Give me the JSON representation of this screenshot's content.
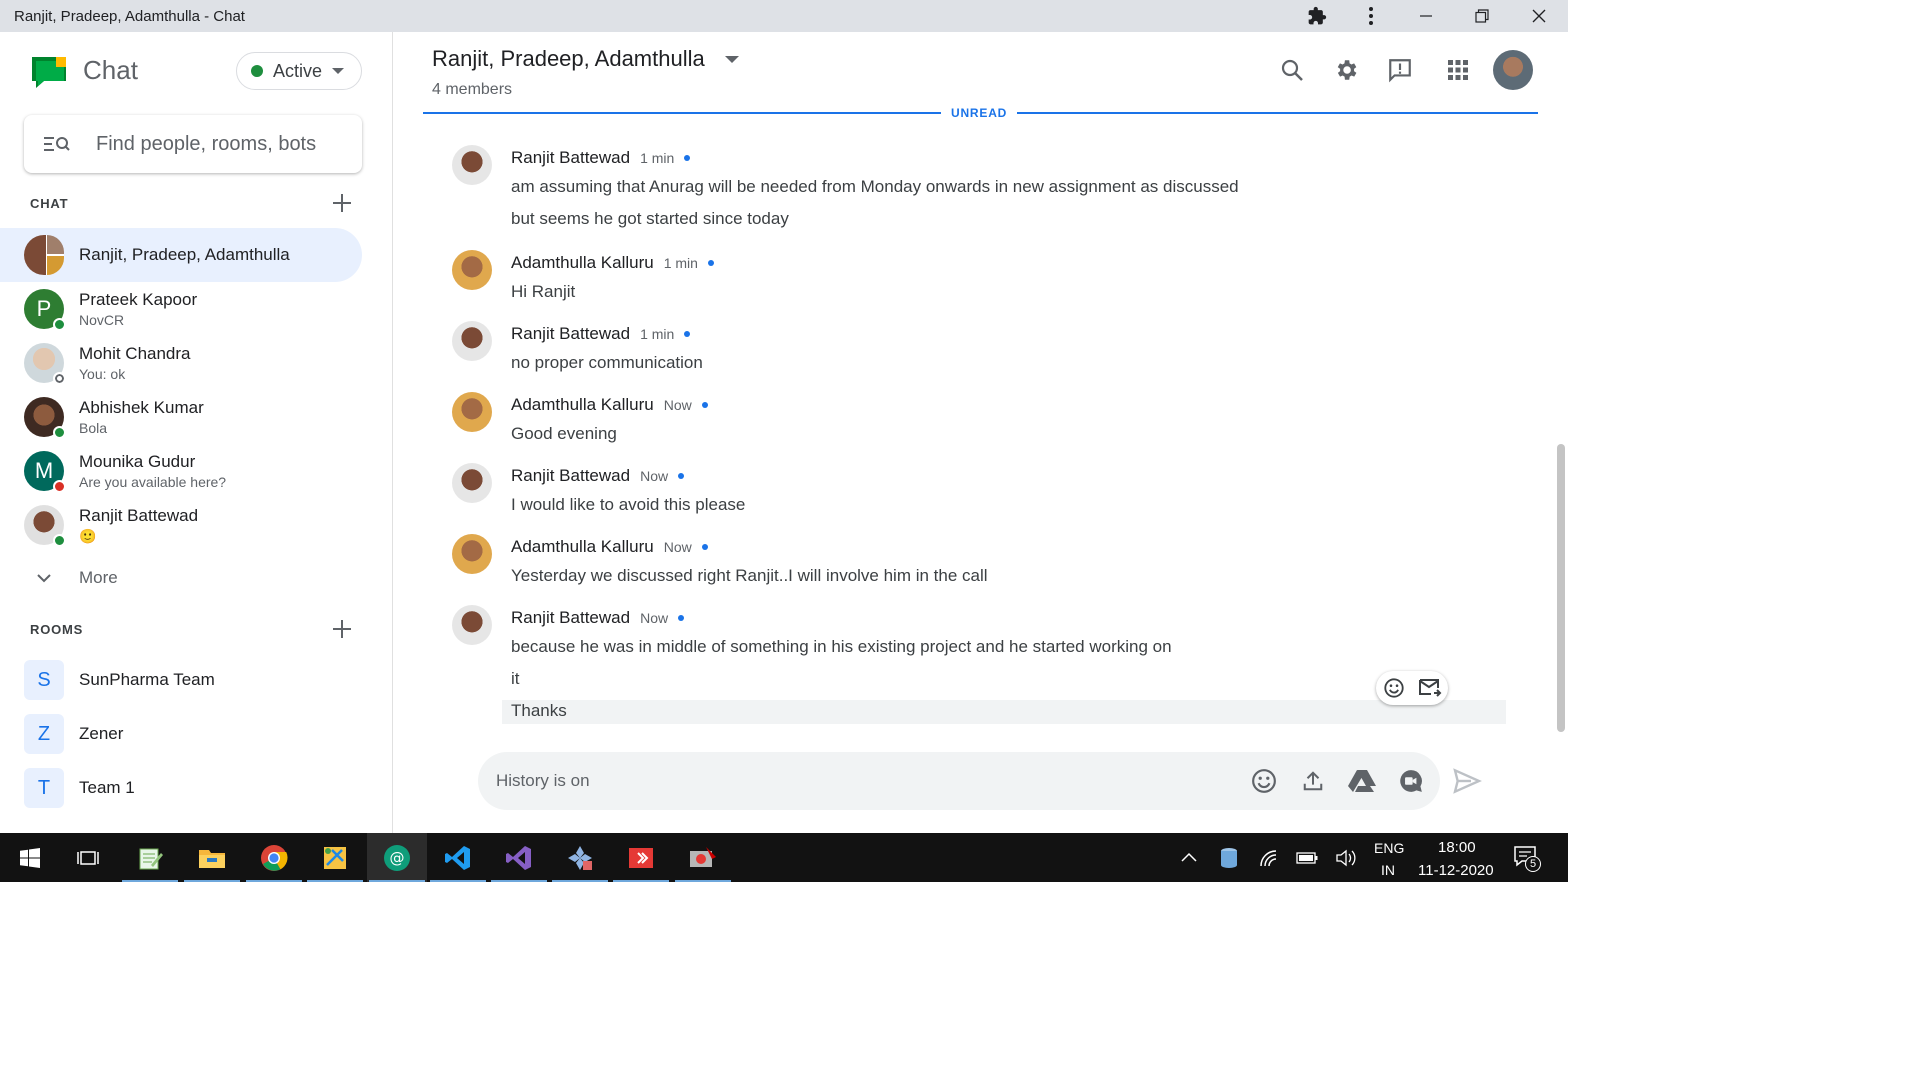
{
  "window": {
    "title": "Ranjit, Pradeep, Adamthulla - Chat"
  },
  "sidebar": {
    "app_name": "Chat",
    "status": "Active",
    "search_placeholder": "Find people, rooms, bots",
    "chat_section": "CHAT",
    "chats": [
      {
        "name": "Ranjit, Pradeep, Adamthulla",
        "sub": "",
        "active": true
      },
      {
        "name": "Prateek Kapoor",
        "sub": "NovCR",
        "letter": "P",
        "color": "#2e7d32",
        "presence": "#1e8e3e"
      },
      {
        "name": "Mohit Chandra",
        "sub": "You: ok",
        "presence": "#ffffff"
      },
      {
        "name": "Abhishek Kumar",
        "sub": "Bola",
        "presence": "#1e8e3e"
      },
      {
        "name": "Mounika Gudur",
        "sub": "Are you available here?",
        "letter": "M",
        "color": "#00695c",
        "presence": "#d93025"
      },
      {
        "name": "Ranjit Battewad",
        "sub": "🙂",
        "presence": "#1e8e3e"
      }
    ],
    "more_label": "More",
    "rooms_section": "ROOMS",
    "rooms": [
      {
        "letter": "S",
        "name": "SunPharma Team"
      },
      {
        "letter": "Z",
        "name": "Zener"
      },
      {
        "letter": "T",
        "name": "Team 1"
      }
    ]
  },
  "conversation": {
    "title": "Ranjit, Pradeep, Adamthulla",
    "members": "4 members",
    "unread_label": "UNREAD",
    "messages": [
      {
        "sender": "Ranjit Battewad",
        "time": "1 min",
        "lines": [
          "am assuming that Anurag will be needed from Monday onwards in new assignment as discussed",
          "but seems he got started since today"
        ]
      },
      {
        "sender": "Adamthulla Kalluru",
        "time": "1 min",
        "lines": [
          "Hi Ranjit"
        ]
      },
      {
        "sender": "Ranjit Battewad",
        "time": "1 min",
        "lines": [
          "no proper communication"
        ]
      },
      {
        "sender": "Adamthulla Kalluru",
        "time": "Now",
        "lines": [
          "Good evening"
        ]
      },
      {
        "sender": "Ranjit Battewad",
        "time": "Now",
        "lines": [
          "I would like to avoid this please"
        ]
      },
      {
        "sender": "Adamthulla Kalluru",
        "time": "Now",
        "lines": [
          "Yesterday we discussed right Ranjit..I will involve him in the call"
        ]
      },
      {
        "sender": "Ranjit Battewad",
        "time": "Now",
        "lines": [
          "because he was in middle of something in his existing project and he started working on",
          "it",
          "Thanks"
        ]
      }
    ],
    "composer_placeholder": "History is on"
  },
  "taskbar": {
    "language": "ENG",
    "region": "IN",
    "time": "18:00",
    "date": "11-12-2020",
    "notification_count": "5"
  },
  "colors": {
    "accent": "#1a73e8",
    "active_status": "#1e8e3e",
    "active_row": "#e8f0fe"
  }
}
